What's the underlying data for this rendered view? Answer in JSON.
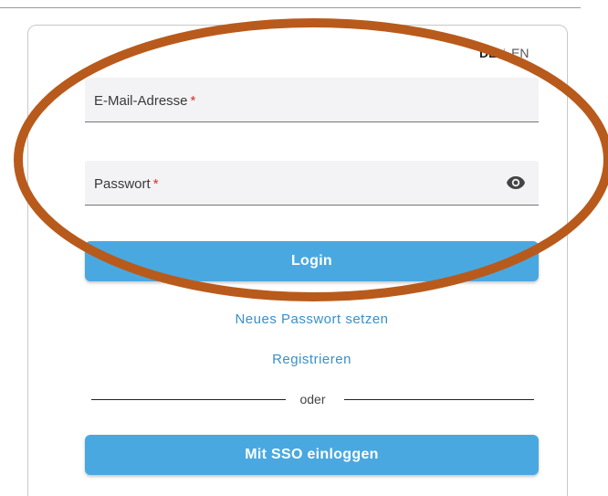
{
  "language_switch": {
    "active": "DE",
    "separator": "|",
    "other": "EN"
  },
  "form": {
    "email": {
      "label": "E-Mail-Adresse",
      "required_mark": "*"
    },
    "password": {
      "label": "Passwort",
      "required_mark": "*",
      "toggle_icon": "eye-icon"
    },
    "login_button": "Login",
    "reset_password_link": "Neues Passwort setzen",
    "register_link": "Registrieren",
    "divider_text": "oder",
    "sso_button": "Mit SSO einloggen"
  },
  "colors": {
    "primary_button": "#4aa8e0",
    "link": "#3b8fc9",
    "required": "#d32f2f",
    "annotation_ellipse": "#b85a1c"
  }
}
